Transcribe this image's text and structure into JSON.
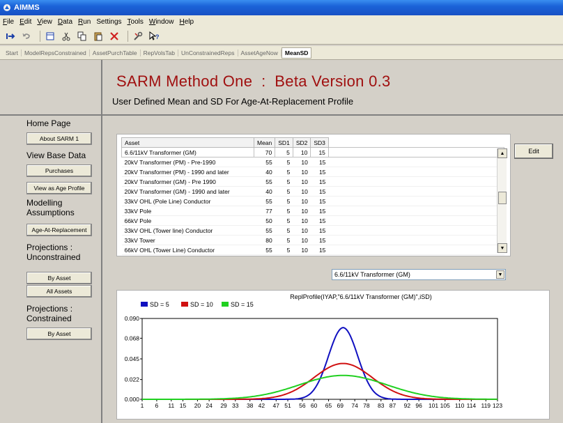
{
  "window": {
    "title": "AIMMS"
  },
  "menu": [
    {
      "key": "F",
      "rest": "ile"
    },
    {
      "key": "E",
      "rest": "dit"
    },
    {
      "key": "V",
      "rest": "iew"
    },
    {
      "key": "D",
      "rest": "ata"
    },
    {
      "key": "R",
      "rest": "un"
    },
    {
      "key": "",
      "rest": "Settings"
    },
    {
      "key": "T",
      "rest": "ools"
    },
    {
      "key": "W",
      "rest": "indow"
    },
    {
      "key": "H",
      "rest": "elp"
    }
  ],
  "toolbar": {
    "icons": [
      "exit-icon",
      "undo-icon",
      "page-icon",
      "cut-icon",
      "copy-icon",
      "paste-icon",
      "delete-icon",
      "tools-icon",
      "help-pointer-icon"
    ]
  },
  "tabs": [
    {
      "label": "Start",
      "active": false
    },
    {
      "label": "ModelRepsConstrained",
      "active": false
    },
    {
      "label": "AssetPurchTable",
      "active": false
    },
    {
      "label": "RepVolsTab",
      "active": false
    },
    {
      "label": "UnConstrainedReps",
      "active": false
    },
    {
      "label": "AssetAgeNow",
      "active": false
    },
    {
      "label": "MeanSD",
      "active": true
    }
  ],
  "header": {
    "title": "SARM Method One  :  Beta Version 0.3",
    "subtitle": "User Defined Mean and SD For Age-At-Replacement Profile"
  },
  "sidebar": {
    "home_label": "Home Page",
    "about_button": "About SARM 1",
    "view_base_label": "View Base Data",
    "purchases_button": "Purchases",
    "age_profile_button": "View as Age Profile",
    "modelling_label_1": "Modelling",
    "modelling_label_2": "Assumptions",
    "age_replacement_button": "Age-At-Replacement",
    "proj_uncon_label_1": "Projections :",
    "proj_uncon_label_2": "Unconstrained",
    "by_asset_button_1": "By Asset",
    "all_assets_button": "All Assets",
    "proj_con_label_1": "Projections :",
    "proj_con_label_2": "Constrained",
    "by_asset_button_2": "By Asset"
  },
  "table": {
    "headers": [
      "Asset",
      "Mean",
      "SD1",
      "SD2",
      "SD3"
    ],
    "rows": [
      [
        "6.6/11kV Transformer (GM)",
        "70",
        "5",
        "10",
        "15"
      ],
      [
        "20kV Transformer (PM) - Pre-1990",
        "55",
        "5",
        "10",
        "15"
      ],
      [
        "20kV Transformer (PM) - 1990 and later",
        "40",
        "5",
        "10",
        "15"
      ],
      [
        "20kV Transformer (GM) - Pre 1990",
        "55",
        "5",
        "10",
        "15"
      ],
      [
        "20kV Transformer (GM)  - 1990 and later",
        "40",
        "5",
        "10",
        "15"
      ],
      [
        "33kV OHL (Pole Line) Conductor",
        "55",
        "5",
        "10",
        "15"
      ],
      [
        "33kV Pole",
        "77",
        "5",
        "10",
        "15"
      ],
      [
        "66kV Pole",
        "50",
        "5",
        "10",
        "15"
      ],
      [
        "33kV OHL (Tower line) Conductor",
        "55",
        "5",
        "10",
        "15"
      ],
      [
        "33kV Tower",
        "80",
        "5",
        "10",
        "15"
      ],
      [
        "66kV OHL (Tower Line) Conductor",
        "55",
        "5",
        "10",
        "15"
      ]
    ]
  },
  "edit_button": "Edit",
  "asset_select": {
    "value": "6.6/11kV Transformer (GM)"
  },
  "chart_data": {
    "type": "line",
    "title": "ReplProfile(IYAP,\"6.6/11kV Transformer (GM)\",iSD)",
    "legend_position": "top-left",
    "x_ticks": [
      "1",
      "6",
      "11",
      "15",
      "20",
      "24",
      "29",
      "33",
      "38",
      "42",
      "47",
      "51",
      "56",
      "60",
      "65",
      "69",
      "74",
      "78",
      "83",
      "87",
      "92",
      "96",
      "101",
      "105",
      "110",
      "114",
      "119",
      "123"
    ],
    "xlim": [
      1,
      123
    ],
    "y_ticks": [
      "0.000",
      "0.022",
      "0.045",
      "0.068",
      "0.090"
    ],
    "ylim": [
      0,
      0.09
    ],
    "mean": 70,
    "series": [
      {
        "name": "SD = 5",
        "sd": 5,
        "color": "#1010c0",
        "peak": 0.0798
      },
      {
        "name": "SD = 10",
        "sd": 10,
        "color": "#d01010",
        "peak": 0.0399
      },
      {
        "name": "SD = 15",
        "sd": 15,
        "color": "#20d020",
        "peak": 0.0266
      }
    ]
  }
}
